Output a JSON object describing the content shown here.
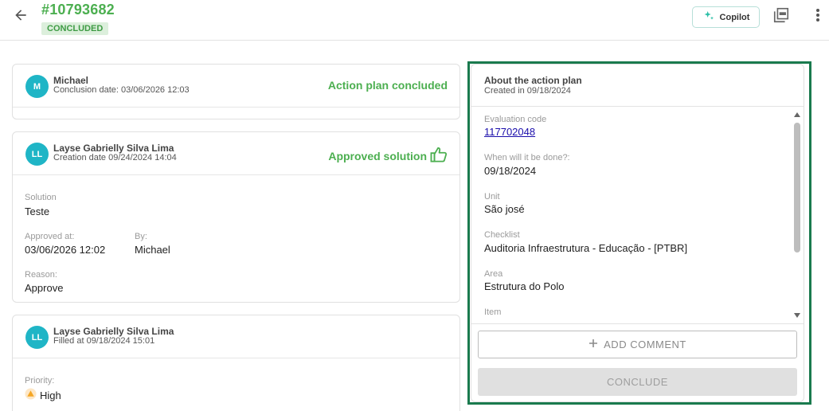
{
  "header": {
    "plan_id": "#10793682",
    "status": "CONCLUDED",
    "copilot_label": "Copilot"
  },
  "cards": [
    {
      "avatar": "M",
      "name": "Michael",
      "subtitle": "Conclusion date: 03/06/2026 12:03",
      "status": "Action plan concluded"
    },
    {
      "avatar": "LL",
      "name": "Layse Gabrielly Silva Lima",
      "subtitle": "Creation date 09/24/2024 14:04",
      "status": "Approved solution",
      "solution_label": "Solution",
      "solution_value": "Teste",
      "approved_at_label": "Approved at:",
      "approved_at_value": "03/06/2026 12:02",
      "by_label": "By:",
      "by_value": "Michael",
      "reason_label": "Reason:",
      "reason_value": "Approve"
    },
    {
      "avatar": "LL",
      "name": "Layse Gabrielly Silva Lima",
      "subtitle": "Filled at 09/18/2024 15:01",
      "priority_label": "Priority:",
      "priority_value": "High"
    }
  ],
  "panel": {
    "title": "About the action plan",
    "subtitle": "Created in 09/18/2024",
    "fields": [
      {
        "label": "Evaluation code",
        "value": "117702048"
      },
      {
        "label": "When will it be done?:",
        "value": "09/18/2024"
      },
      {
        "label": "Unit",
        "value": "São josé"
      },
      {
        "label": "Checklist",
        "value": "Auditoria Infraestrutura - Educação - [PTBR]"
      },
      {
        "label": "Area",
        "value": "Estrutura do Polo"
      },
      {
        "label": "Item",
        "value": ""
      }
    ],
    "add_comment_label": "ADD COMMENT",
    "conclude_label": "CONCLUDE"
  },
  "colors": {
    "brand_green": "#4caf50",
    "avatar_teal": "#1fb5c6",
    "focus_frame": "#1a7a4e",
    "link": "#1a0dab",
    "priority_high": "#f5a623"
  }
}
